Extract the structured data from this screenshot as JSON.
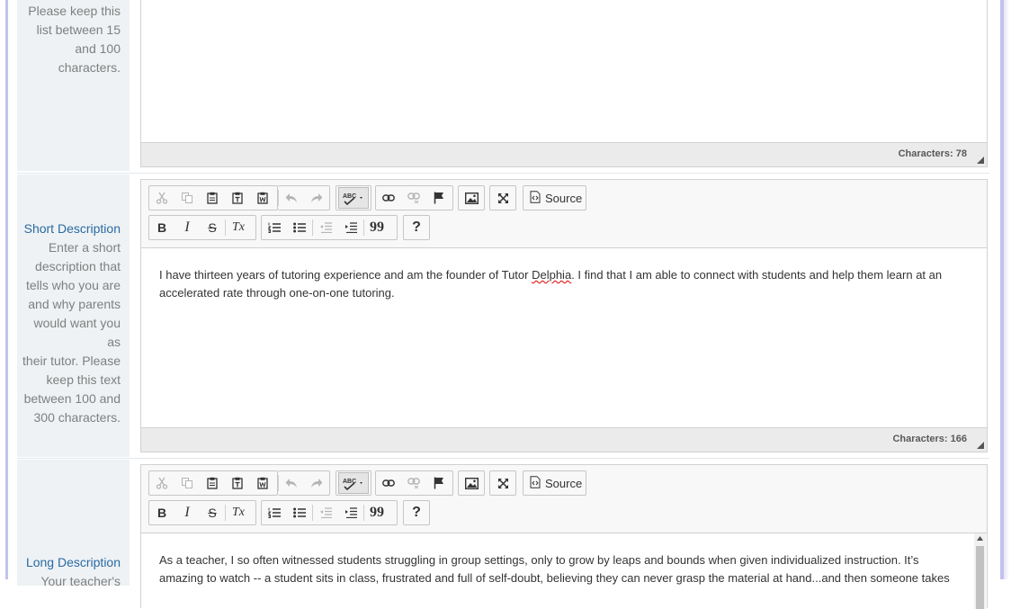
{
  "colors": {
    "frame": "#c2c2ee",
    "label_bg": "#eef2f4",
    "label_title": "#2a6aa4",
    "label_text": "#7f7f7f",
    "toolbar_bg": "#f8f8f8",
    "footer_bg": "#ebebeb"
  },
  "top_section": {
    "label_lines": [
      "Please keep this",
      "list between 15",
      "and 100",
      "characters."
    ],
    "char_count": "Characters: 78"
  },
  "short_section": {
    "title": "Short Description",
    "label_lines": [
      "Enter a short",
      "description that",
      "tells who you are",
      "and why parents",
      "would want you as",
      "their tutor. Please",
      "keep this text",
      "between 100 and",
      "300 characters."
    ],
    "content_line1_a": "I have thirteen years of tutoring experience and am the founder of Tutor ",
    "content_line1_misspelled": "Delphia",
    "content_line1_b": ". I find that I am able to connect with students and help them learn at an",
    "content_line2": "accelerated rate through one-on-one tutoring.",
    "char_count": "Characters: 166"
  },
  "long_section": {
    "title": "Long Description",
    "label_partial": "Your teacher's",
    "content_line1": "As a teacher, I so often witnessed students struggling in group settings, only to grow by leaps and bounds when given individualized instruction.  It’s",
    "content_line2": "amazing to watch -- a student sits in class, frustrated and full of self-doubt, believing they can never grasp the material at hand...and then someone takes"
  },
  "toolbar": {
    "icons": [
      "cut-icon",
      "copy-icon",
      "paste-icon",
      "paste-text-icon",
      "paste-word-icon",
      "undo-icon",
      "redo-icon",
      "spellcheck-icon",
      "link-icon",
      "unlink-icon",
      "anchor-icon",
      "image-icon",
      "maximize-icon",
      "source-icon",
      "bold-icon",
      "italic-icon",
      "strike-icon",
      "remove-format-icon",
      "numbered-list-icon",
      "bulleted-list-icon",
      "outdent-icon",
      "indent-icon",
      "blockquote-icon",
      "help-icon"
    ],
    "source_label": "Source",
    "bold_glyph": "B",
    "italic_glyph": "I",
    "strike_glyph": "S",
    "remove_format_glyph": "Tx",
    "help_glyph": "?",
    "quote_glyph": "99",
    "abc_glyph": "ABC"
  }
}
